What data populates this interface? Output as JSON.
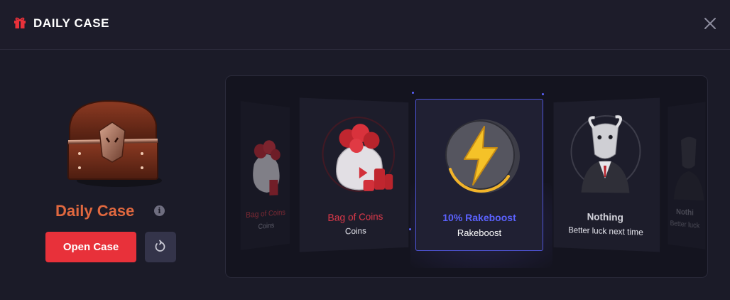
{
  "header": {
    "title": "DAILY CASE",
    "gift_icon": "gift-icon",
    "close_icon": "close-icon"
  },
  "case": {
    "name": "Daily Case",
    "info_icon": "info-icon",
    "info_glyph": "i",
    "open_label": "Open Case",
    "refresh_icon": "refresh-icon",
    "name_color": "#e0683f",
    "button_color": "#e8313a"
  },
  "carousel": {
    "items": [
      {
        "name": "Bag of Coins",
        "sub": "Coins",
        "name_color": "#d03a44",
        "image": "coin-bag-image"
      },
      {
        "name": "Bag of Coins",
        "sub": "Coins",
        "name_color": "#e0394a",
        "image": "coin-bag-image"
      },
      {
        "name": "10% Rakeboost",
        "sub": "Rakeboost",
        "name_color": "#5b62ff",
        "image": "rakeboost-coin-image"
      },
      {
        "name": "Nothing",
        "sub": "Better luck next time",
        "name_color": "#d6d6de",
        "image": "goat-image"
      },
      {
        "name": "Nothi",
        "sub": "Better luck",
        "name_color": "#8a8a96",
        "image": "goat-image"
      }
    ],
    "highlight_color": "#4f55d9"
  }
}
